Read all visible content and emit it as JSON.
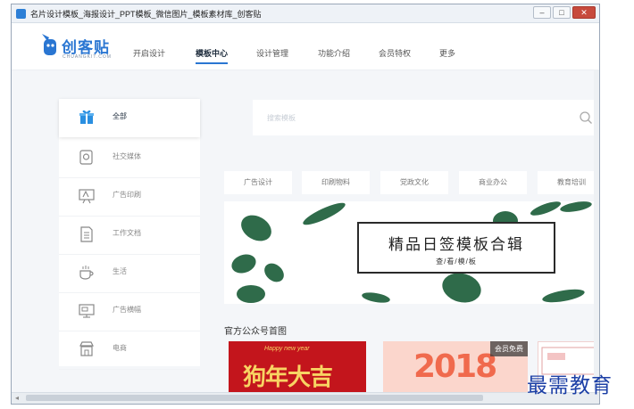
{
  "window": {
    "title": "名片设计模板_海报设计_PPT模板_微信图片_模板素材库_创客贴",
    "controls": {
      "minimize": "–",
      "maximize": "□",
      "close": "✕"
    }
  },
  "logo": {
    "name": "创客贴",
    "sub": "CHUANGKIT.COM",
    "color": "#2a76d2"
  },
  "nav": {
    "items": [
      "开启设计",
      "模板中心",
      "设计管理",
      "功能介绍",
      "会员特权",
      "更多"
    ],
    "active": "模板中心"
  },
  "sidebar": {
    "items": [
      {
        "label": "全部",
        "icon": "gift-box-icon",
        "active": true
      },
      {
        "label": "社交媒体",
        "icon": "social-media-icon",
        "active": false
      },
      {
        "label": "广告印刷",
        "icon": "print-ad-icon",
        "active": false
      },
      {
        "label": "工作文档",
        "icon": "document-icon",
        "active": false
      },
      {
        "label": "生活",
        "icon": "coffee-cup-icon",
        "active": false
      },
      {
        "label": "广告横幅",
        "icon": "banner-screen-icon",
        "active": false
      },
      {
        "label": "电商",
        "icon": "shop-icon",
        "active": false
      }
    ]
  },
  "search": {
    "placeholder": "搜索模板"
  },
  "tags": [
    "广告设计",
    "印刷物料",
    "党政文化",
    "商业办公",
    "教育培训"
  ],
  "banner": {
    "title": "精品日签模板合辑",
    "subtitle": "查/看/模/板"
  },
  "section": {
    "title": "官方公众号首图"
  },
  "cards": {
    "card1_small": "Happy new year",
    "card1_text": "狗年大吉",
    "card2_text": "2018",
    "card2_badge": "会员免费"
  },
  "watermark": "最需教育",
  "colors": {
    "accent": "#2a76d2",
    "card_red": "#c3151c",
    "card_pink": "#fbd6cc"
  }
}
